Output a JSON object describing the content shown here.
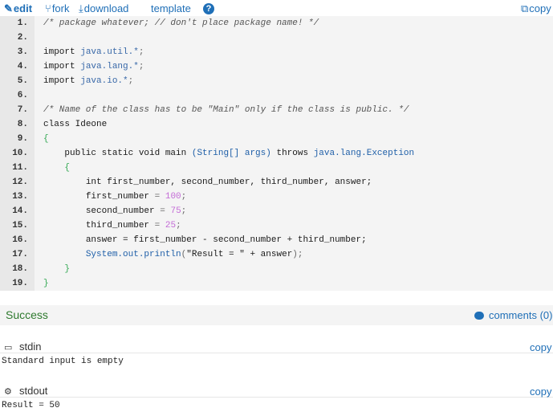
{
  "toolbar": {
    "edit_label": "edit",
    "fork_label": "fork",
    "download_label": "download",
    "template_label": "template",
    "help_label": "?",
    "copy_label": "copy"
  },
  "code": {
    "lines": [
      {
        "num": "1."
      },
      {
        "num": "2."
      },
      {
        "num": "3."
      },
      {
        "num": "4."
      },
      {
        "num": "5."
      },
      {
        "num": "6."
      },
      {
        "num": "7."
      },
      {
        "num": "8."
      },
      {
        "num": "9."
      },
      {
        "num": "10."
      },
      {
        "num": "11."
      },
      {
        "num": "12."
      },
      {
        "num": "13."
      },
      {
        "num": "14."
      },
      {
        "num": "15."
      },
      {
        "num": "16."
      },
      {
        "num": "17."
      },
      {
        "num": "18."
      },
      {
        "num": "19."
      }
    ],
    "text": {
      "l1": "/* package whatever; // don't place package name! */",
      "l3_kw": "import",
      "l3_pkg": "java.util.*",
      "l4_kw": "import",
      "l4_pkg": "java.lang.*",
      "l5_kw": "import",
      "l5_pkg": "java.io.*",
      "l7": "/* Name of the class has to be \"Main\" only if the class is public. */",
      "l8_kw": "class",
      "l8_name": "Ideone",
      "l9": "{",
      "l10_kw": "public static void main",
      "l10_args": "(String[] args)",
      "l10_throws": "throws",
      "l10_exc": "java.lang.Exception",
      "l11": "{",
      "l12": "int first_number, second_number, third_number, answer;",
      "l13_var": "first_number",
      "l13_val": "100",
      "l14_var": "second_number",
      "l14_val": "75",
      "l15_var": "third_number",
      "l15_val": "25",
      "l16": "answer = first_number - second_number + third_number;",
      "l17_call": "System.out.println",
      "l17_str": "\"Result = \"",
      "l17_rest": "+ answer",
      "l18": "}",
      "l19": "}"
    }
  },
  "status": {
    "result": "Success",
    "comments_label": "comments (0)"
  },
  "stdin": {
    "title": "stdin",
    "copy_label": "copy",
    "content": "Standard input is empty"
  },
  "stdout": {
    "title": "stdout",
    "copy_label": "copy",
    "content": "Result = 50"
  },
  "colors": {
    "link": "#1f6fb7",
    "success": "#2e7a2e",
    "number": "#c36bd6"
  }
}
